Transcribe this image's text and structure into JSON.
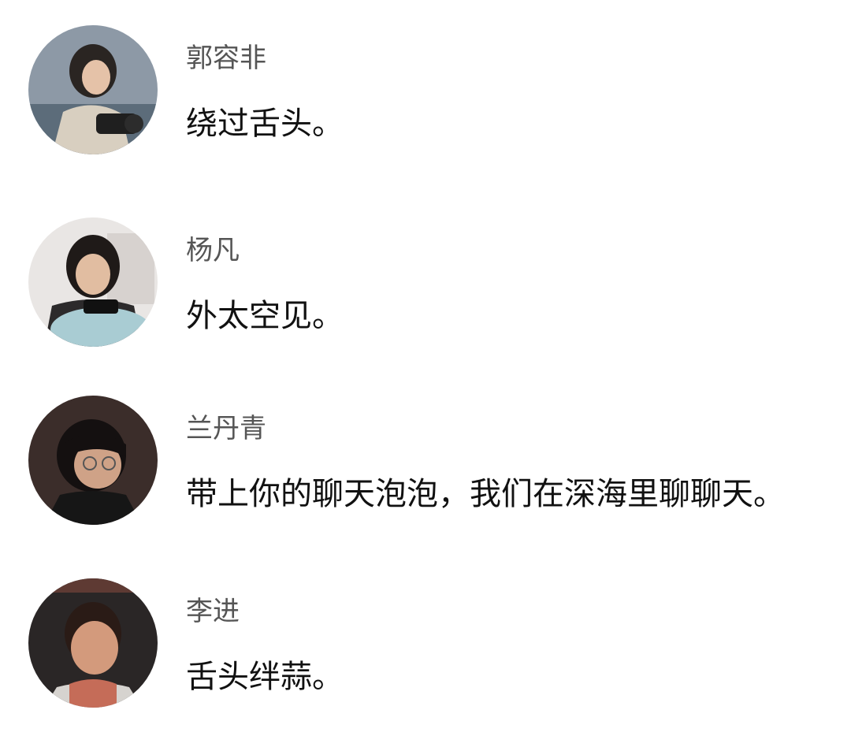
{
  "messages": [
    {
      "name": "郭容非",
      "text": "绕过舌头。",
      "avatar_icon": "profile-photo-icon"
    },
    {
      "name": "杨凡",
      "text": "外太空见。",
      "avatar_icon": "profile-photo-icon"
    },
    {
      "name": "兰丹青",
      "text": "带上你的聊天泡泡，我们在深海里聊聊天。",
      "avatar_icon": "profile-photo-icon"
    },
    {
      "name": "李进",
      "text": "舌头绊蒜。",
      "avatar_icon": "profile-photo-icon"
    }
  ]
}
